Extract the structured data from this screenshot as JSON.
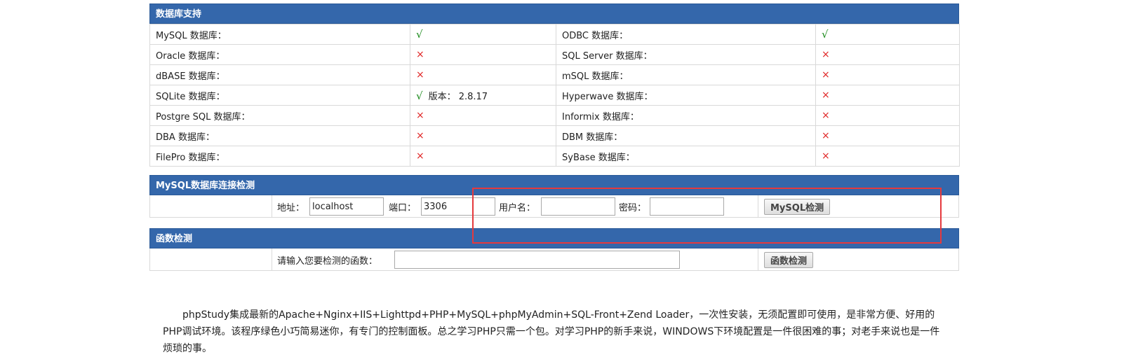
{
  "db_support": {
    "title": "数据库支持",
    "rows": [
      {
        "l_name": "MySQL 数据库：",
        "l_status": "√",
        "l_ok": true,
        "l_extra": "",
        "r_name": "ODBC 数据库：",
        "r_status": "√",
        "r_ok": true
      },
      {
        "l_name": "Oracle 数据库：",
        "l_status": "×",
        "l_ok": false,
        "l_extra": "",
        "r_name": "SQL Server 数据库：",
        "r_status": "×",
        "r_ok": false
      },
      {
        "l_name": "dBASE 数据库：",
        "l_status": "×",
        "l_ok": false,
        "l_extra": "",
        "r_name": "mSQL 数据库：",
        "r_status": "×",
        "r_ok": false
      },
      {
        "l_name": "SQLite 数据库：",
        "l_status": "√",
        "l_ok": true,
        "l_extra": "版本： 2.8.17",
        "r_name": "Hyperwave 数据库：",
        "r_status": "×",
        "r_ok": false
      },
      {
        "l_name": "Postgre SQL 数据库：",
        "l_status": "×",
        "l_ok": false,
        "l_extra": "",
        "r_name": "Informix 数据库：",
        "r_status": "×",
        "r_ok": false
      },
      {
        "l_name": "DBA 数据库：",
        "l_status": "×",
        "l_ok": false,
        "l_extra": "",
        "r_name": "DBM 数据库：",
        "r_status": "×",
        "r_ok": false
      },
      {
        "l_name": "FilePro 数据库：",
        "l_status": "×",
        "l_ok": false,
        "l_extra": "",
        "r_name": "SyBase 数据库：",
        "r_status": "×",
        "r_ok": false
      }
    ]
  },
  "mysql_check": {
    "title": "MySQL数据库连接检测",
    "host_label": "地址：",
    "host_value": "localhost",
    "port_label": "端口：",
    "port_value": "3306",
    "user_label": "用户名：",
    "user_value": "",
    "pass_label": "密码：",
    "pass_value": "",
    "button": "MySQL检测"
  },
  "func_check": {
    "title": "函数检测",
    "label": "请输入您要检测的函数：",
    "value": "",
    "button": "函数检测"
  },
  "description": "phpStudy集成最新的Apache+Nginx+IIS+Lighttpd+PHP+MySQL+phpMyAdmin+SQL-Front+Zend Loader，一次性安装，无须配置即可使用，是非常方便、好用的PHP调试环境。该程序绿色小巧简易迷你，有专门的控制面板。总之学习PHP只需一个包。对学习PHP的新手来说，WINDOWS下环境配置是一件很困难的事；对老手来说也是一件烦琐的事。",
  "colors": {
    "header_bg": "#3467ab",
    "ok": "#1a8a1a",
    "no": "#e02424",
    "highlight": "#e5393d"
  }
}
